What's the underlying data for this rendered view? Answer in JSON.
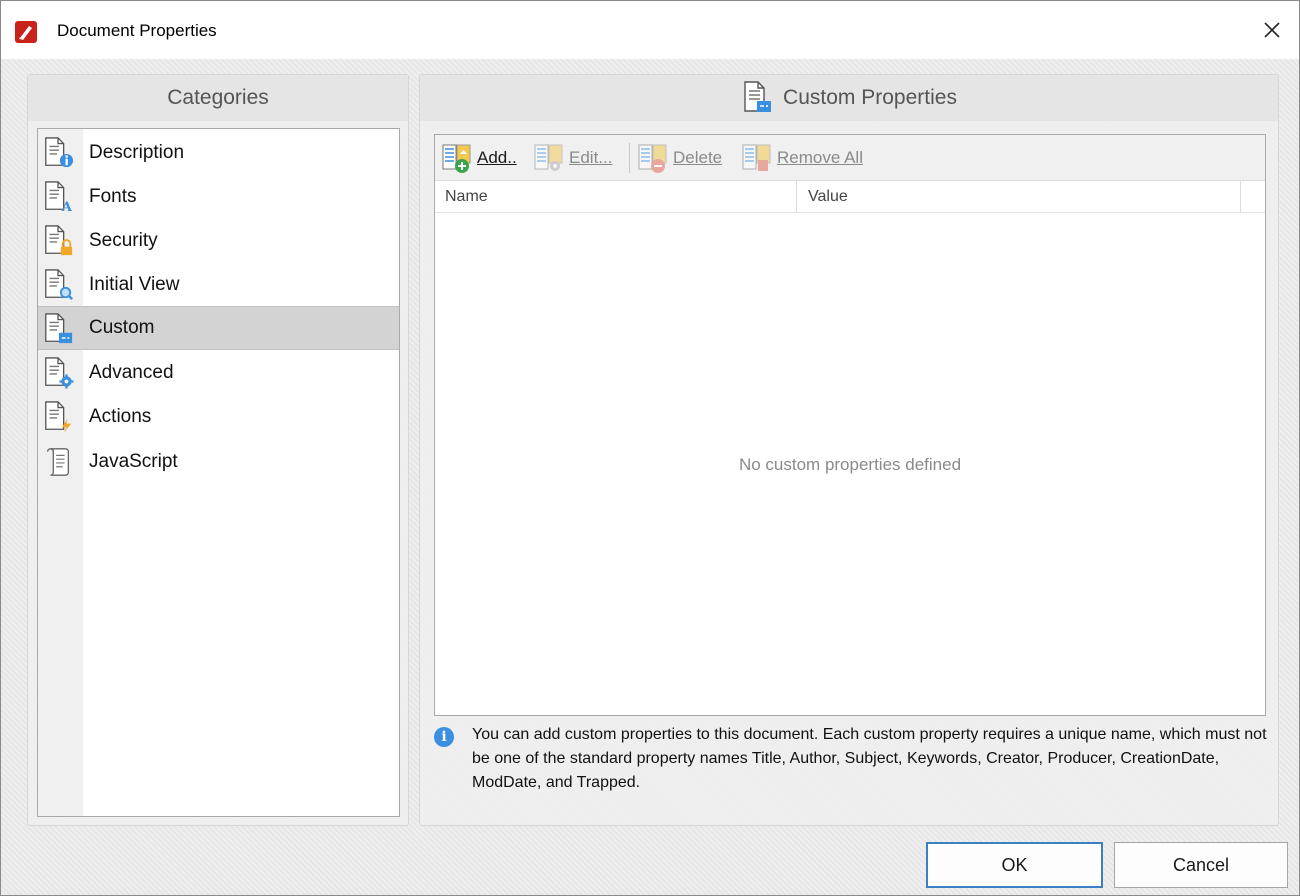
{
  "window": {
    "title": "Document Properties",
    "close_icon": "close-icon"
  },
  "categories": {
    "header": "Categories",
    "items": [
      {
        "label": "Description",
        "icon": "document-info-icon",
        "selected": false
      },
      {
        "label": "Fonts",
        "icon": "document-font-icon",
        "selected": false
      },
      {
        "label": "Security",
        "icon": "document-lock-icon",
        "selected": false
      },
      {
        "label": "Initial View",
        "icon": "document-magnifier-icon",
        "selected": false
      },
      {
        "label": "Custom",
        "icon": "document-custom-icon",
        "selected": true
      },
      {
        "label": "Advanced",
        "icon": "document-gear-icon",
        "selected": false
      },
      {
        "label": "Actions",
        "icon": "document-lightning-icon",
        "selected": false
      },
      {
        "label": "JavaScript",
        "icon": "scroll-script-icon",
        "selected": false
      }
    ]
  },
  "custom": {
    "header": "Custom Properties",
    "toolbar": {
      "add_label": "Add..",
      "edit_label": "Edit...",
      "delete_label": "Delete",
      "remove_all_label": "Remove All"
    },
    "columns": {
      "name": "Name",
      "value": "Value"
    },
    "empty_message": "No custom properties defined",
    "info": "You can add custom properties to this document. Each custom property requires a unique name, which must not be one of the standard property names Title, Author, Subject, Keywords, Creator, Producer, CreationDate, ModDate, and Trapped."
  },
  "buttons": {
    "ok": "OK",
    "cancel": "Cancel"
  },
  "colors": {
    "accent": "#3c7fc2",
    "info": "#3b8fe0",
    "logo": "#c8221b"
  }
}
